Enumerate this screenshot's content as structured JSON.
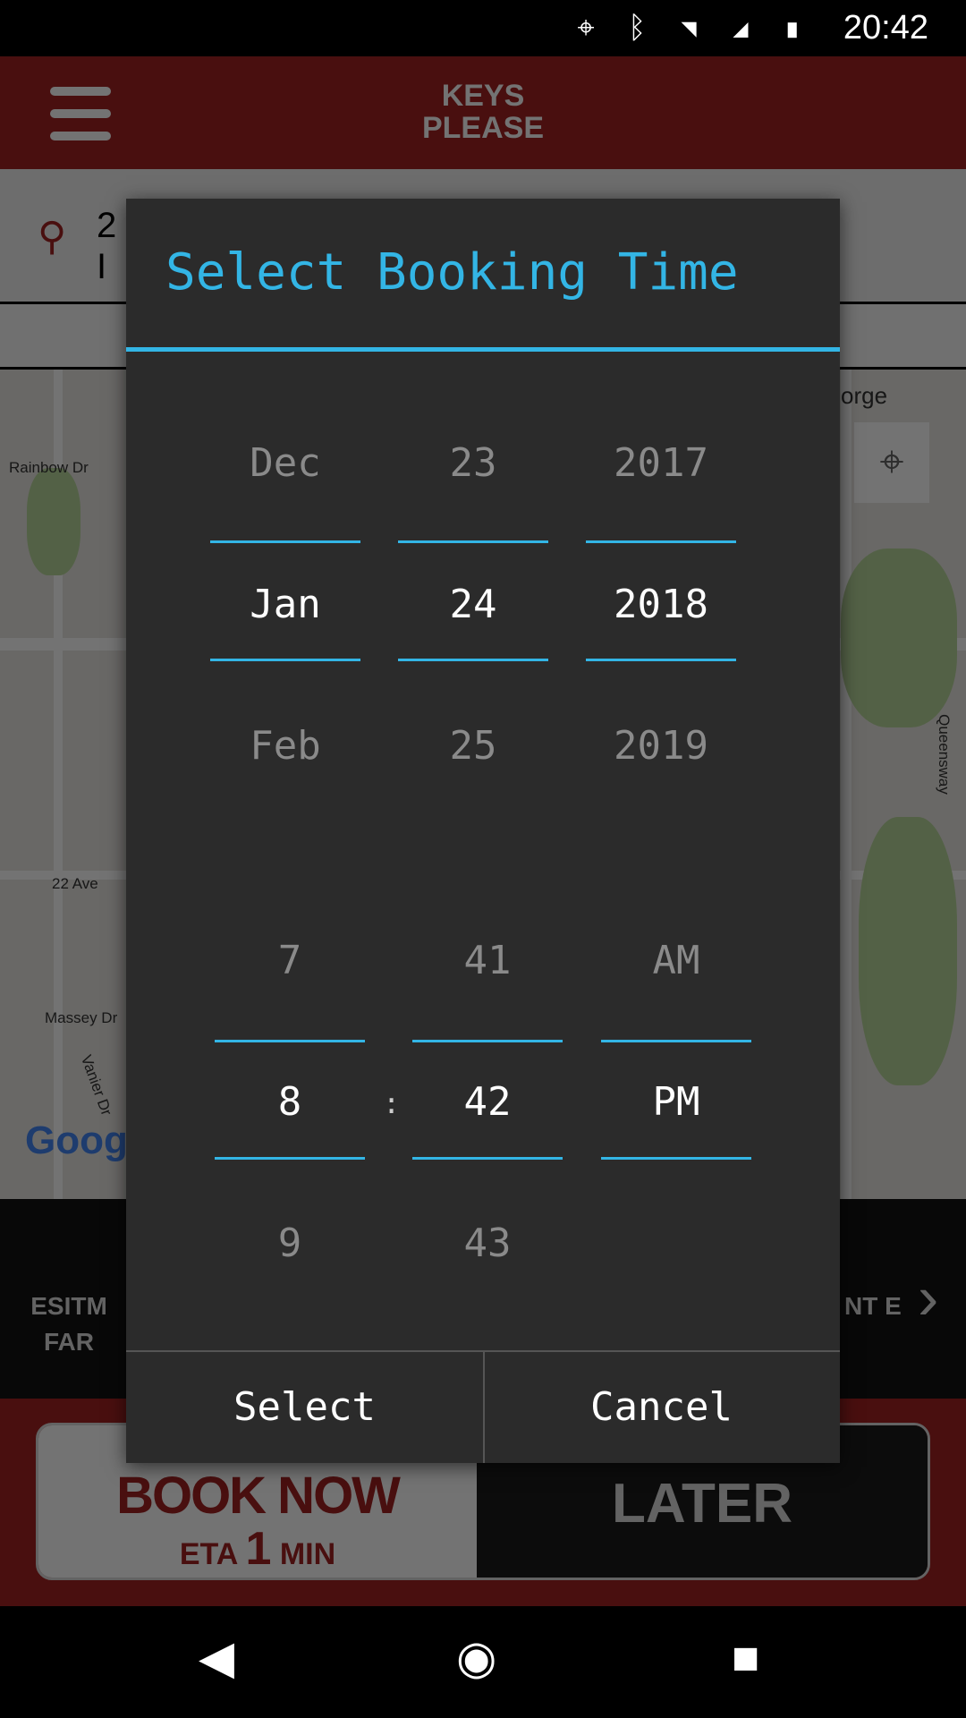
{
  "status_bar": {
    "time": "20:42",
    "icons": [
      "location-icon",
      "bluetooth-icon",
      "wifi-icon",
      "signal-icon",
      "battery-icon"
    ]
  },
  "app_bar": {
    "logo": "KEYS PLEASE"
  },
  "search": {
    "line1": "2",
    "line2": "I"
  },
  "map": {
    "labels": [
      "Rainbow Dr",
      "22 Ave",
      "Massey Dr",
      "Vanier Dr",
      "Queensway",
      "orge"
    ],
    "google": "Goog"
  },
  "strip": {
    "left_label": "ESITM FAR",
    "right_label": "NT E"
  },
  "booking": {
    "now": "BOOK NOW",
    "eta_prefix": "ETA",
    "eta_value": "1",
    "eta_unit": "MIN",
    "later": "LATER"
  },
  "dialog": {
    "title": "Select Booking Time",
    "date": {
      "month": [
        "Dec",
        "Jan",
        "Feb"
      ],
      "day": [
        "23",
        "24",
        "25"
      ],
      "year": [
        "2017",
        "2018",
        "2019"
      ]
    },
    "time": {
      "hour": [
        "7",
        "8",
        "9"
      ],
      "minute": [
        "41",
        "42",
        "43"
      ],
      "ampm": [
        "AM",
        "PM",
        ""
      ],
      "separator": ":"
    },
    "select_label": "Select",
    "cancel_label": "Cancel",
    "accent": "#33b5e5"
  }
}
